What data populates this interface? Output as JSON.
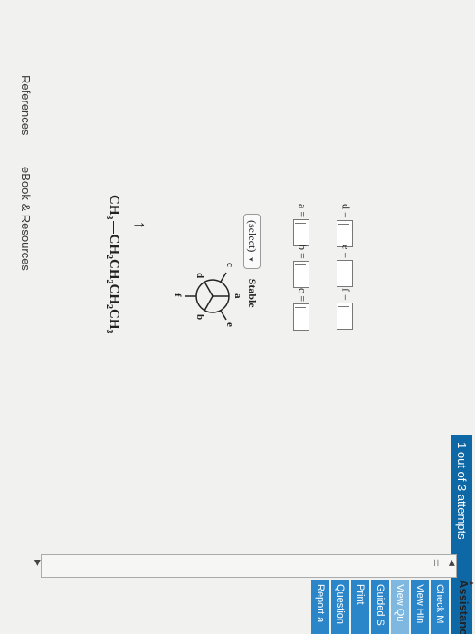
{
  "attempts": "1 out of 3 attempts",
  "assistance": {
    "title": "Assistanc",
    "items": [
      "Check M",
      "View Hin",
      "View Qu",
      "Guided S",
      "Print",
      "Question",
      "Report a"
    ],
    "colors": [
      "#2a86c9",
      "#2a86c9",
      "#7eb7e0",
      "#2a86c9",
      "#2a86c9",
      "#2a86c9",
      "#2a86c9"
    ]
  },
  "question": {
    "formula_left": "CH",
    "formula_left_sub": "3",
    "formula_right": "CH",
    "formula_right_parts": [
      "CH",
      "2",
      "CH",
      "2",
      "CH",
      "2",
      "CH",
      "3"
    ],
    "arrow": "↑",
    "newman_labels": {
      "a": "a",
      "b": "b",
      "c": "c",
      "d": "d",
      "e": "e",
      "f": "f"
    },
    "select_value": "(select)",
    "select_suffix": "Stable",
    "fields": [
      {
        "label": "a ="
      },
      {
        "label": "b ="
      },
      {
        "label": "c ="
      },
      {
        "label": "d ="
      },
      {
        "label": "e ="
      },
      {
        "label": "f ="
      }
    ]
  },
  "links": {
    "references": "References",
    "ebook": "eBook & Resources"
  },
  "icons": {
    "scroll_left": "triangle-left-icon",
    "scroll_right": "triangle-right-icon",
    "grip": "grip-icon",
    "dropdown": "chevron-down-icon"
  }
}
